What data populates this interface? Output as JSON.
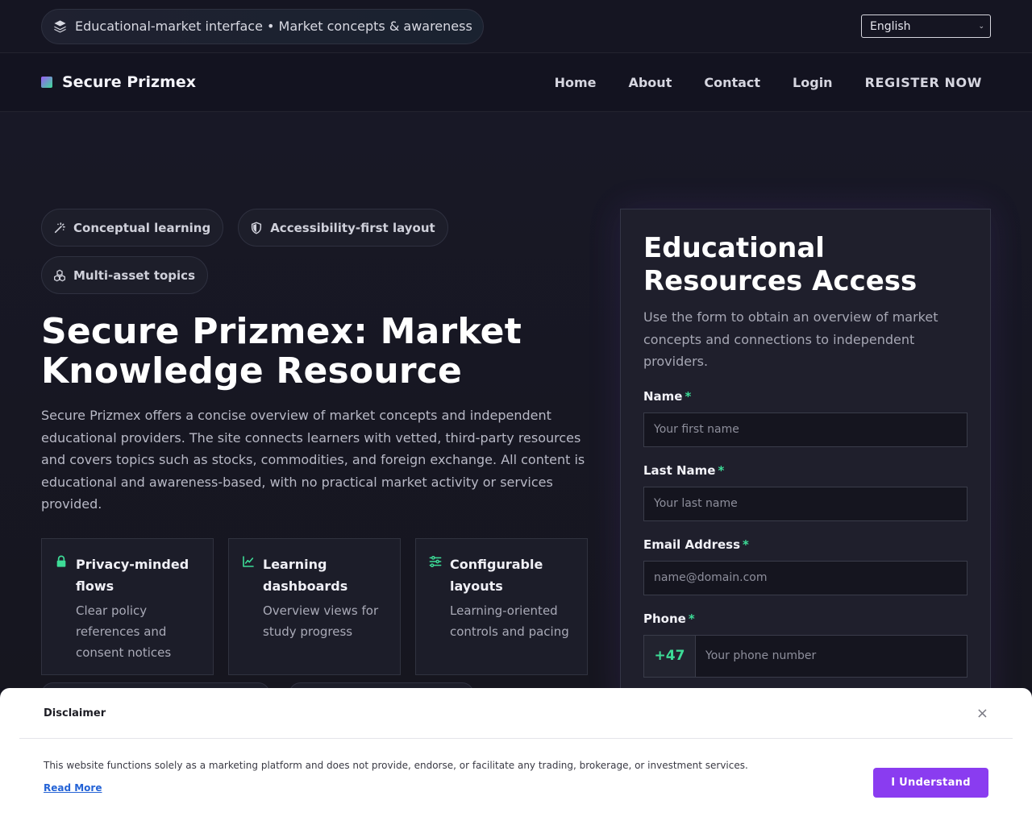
{
  "topbar": {
    "info_pill": "Educational-market interface • Market concepts & awareness",
    "language": "English"
  },
  "nav": {
    "brand": "Secure Prizmex",
    "links": [
      "Home",
      "About",
      "Contact",
      "Login",
      "REGISTER NOW"
    ]
  },
  "hero": {
    "tags": [
      "Conceptual learning",
      "Accessibility-first layout",
      "Multi-asset topics"
    ],
    "title": "Secure Prizmex: Market Knowledge Resource",
    "description": "Secure Prizmex offers a concise overview of market concepts and independent educational providers. The site connects learners with vetted, third-party resources and covers topics such as stocks, commodities, and foreign exchange. All content is educational and awareness-based, with no practical market activity or services provided.",
    "features": [
      {
        "title": "Privacy-minded flows",
        "text": "Clear policy references and consent notices",
        "icon": "lock-icon"
      },
      {
        "title": "Learning dashboards",
        "text": "Overview views for study progress",
        "icon": "chart-line-icon"
      },
      {
        "title": "Configurable layouts",
        "text": "Learning-oriented controls and pacing",
        "icon": "sliders-icon"
      }
    ]
  },
  "form": {
    "title": "Educational Resources Access",
    "subtitle": "Use the form to obtain an overview of market concepts and connections to independent providers.",
    "required_mark": "*",
    "name_label": "Name",
    "name_placeholder": "Your first name",
    "last_label": "Last Name",
    "last_placeholder": "Your last name",
    "email_label": "Email Address",
    "email_placeholder": "name@domain.com",
    "phone_label": "Phone",
    "phone_code": "+47",
    "phone_placeholder": "Your phone number"
  },
  "disclaimer": {
    "title": "Disclaimer",
    "close": "×",
    "text": "This website functions solely as a marketing platform and does not provide, endorse, or facilitate any trading, brokerage, or investment services.",
    "link": "Read More",
    "button": "I Understand"
  },
  "colors": {
    "accent_green": "#3ddc97",
    "accent_purple": "#8a3cf0",
    "background": "#14141f"
  }
}
